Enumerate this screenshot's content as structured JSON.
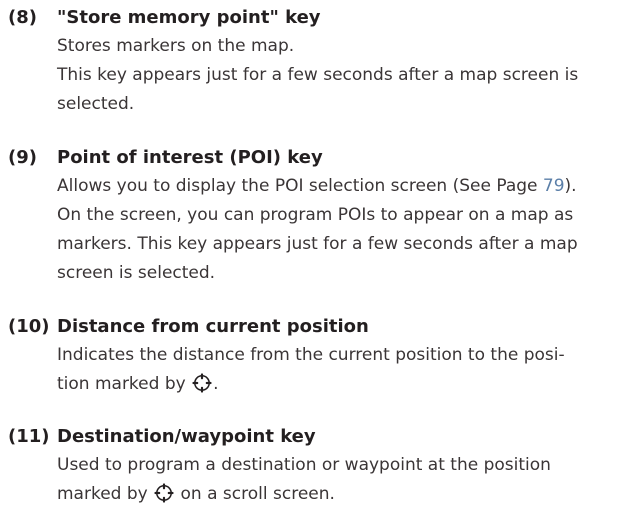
{
  "items": [
    {
      "number": "(8)",
      "title": "\"Store memory point\" key",
      "lines": [
        "Stores markers on the map.",
        "This key appears just for a few seconds after a map screen is",
        "selected."
      ]
    },
    {
      "number": "(9)",
      "title": "Point of interest (POI) key",
      "line1_before": "Allows you to display the POI selection screen (See Page ",
      "page_ref": "79",
      "line1_after": ").",
      "lines": [
        "On the screen, you can program POIs to appear on a map as",
        "markers. This key appears just for a few seconds after a map",
        "screen is selected."
      ]
    },
    {
      "number": "(10)",
      "title": "Distance from current position",
      "line1": "Indicates the distance from the current position to the posi-",
      "line2_before": "tion marked by ",
      "line2_after": "."
    },
    {
      "number": "(11)",
      "title": "Destination/waypoint key",
      "line1": "Used to program a destination or waypoint at the position",
      "line2_before": "marked by ",
      "line2_after": " on a scroll screen."
    }
  ],
  "icons": {
    "cursor": "cursor-crosshair-icon"
  },
  "colors": {
    "text": "#231f20",
    "page_link": "#5b7fa8",
    "icon_stroke": "#231f20"
  }
}
